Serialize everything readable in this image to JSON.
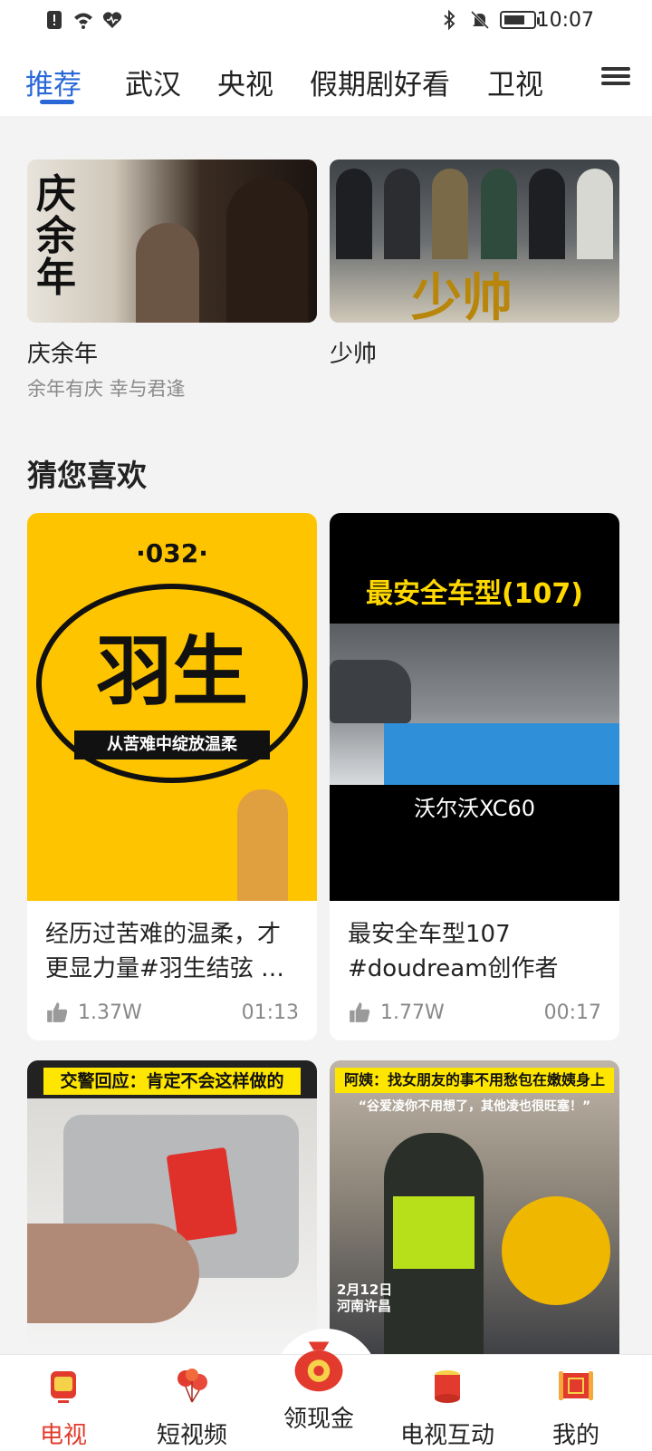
{
  "status": {
    "time": "10:07"
  },
  "tabs": [
    "推荐",
    "武汉",
    "央视",
    "假期剧好看",
    "卫视"
  ],
  "featured": [
    {
      "title": "庆余年",
      "subtitle": "余年有庆 幸与君逢",
      "poster_text": "庆余年"
    },
    {
      "title": "少帅",
      "subtitle": "",
      "poster_text": "少帅"
    }
  ],
  "section": {
    "title": "猜您喜欢"
  },
  "videos": [
    {
      "title": "经历过苦难的温柔，才更显力量#羽生结弦 …",
      "likes": "1.37W",
      "duration": "01:13",
      "thumb_num": "·032·",
      "thumb_big": "羽生",
      "thumb_tag": "从苦难中绽放温柔"
    },
    {
      "title": "最安全车型107 #doudream创作者计…",
      "likes": "1.77W",
      "duration": "00:17",
      "thumb_headline": "最安全车型(107)",
      "thumb_caption": "沃尔沃XC60"
    },
    {
      "thumb_headline": "交警回应：肯定不会这样做的"
    },
    {
      "thumb_headline": "阿姨：找女朋友的事不用愁包在嫩姨身上",
      "thumb_sub": "“谷爱凌你不用想了，其他凌也很旺塞！”",
      "thumb_date": "2月12日 河南许昌"
    }
  ],
  "bottom_nav": [
    {
      "label": "电视",
      "icon": "tv-lantern-icon"
    },
    {
      "label": "短视频",
      "icon": "balloon-icon"
    },
    {
      "label": "领现金",
      "icon": "money-bag-icon"
    },
    {
      "label": "电视互动",
      "icon": "drum-icon"
    },
    {
      "label": "我的",
      "icon": "scroll-icon"
    }
  ],
  "colors": {
    "accent_blue": "#2a68d8",
    "accent_red": "#e23b2d",
    "thumb_yellow": "#ffc400"
  }
}
